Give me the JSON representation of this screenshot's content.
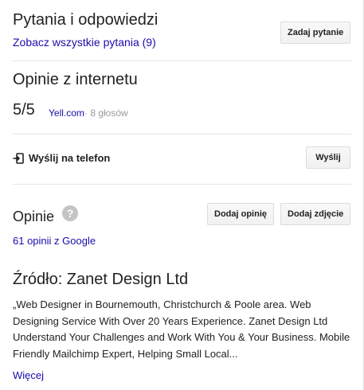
{
  "qa": {
    "title": "Pytania i odpowiedzi",
    "see_all_link": "Zobacz wszystkie pytania (9)",
    "ask_button": "Zadaj pytanie"
  },
  "web_reviews": {
    "title": "Opinie z internetu",
    "score": "5/5",
    "source": "Yell.com",
    "votes": "· 8 głosów"
  },
  "send_to_phone": {
    "label": "Wyślij na telefon",
    "icon": "send-to-phone-icon",
    "button": "Wyślij"
  },
  "reviews": {
    "title": "Opinie",
    "help_icon_glyph": "?",
    "add_review_button": "Dodaj opinię",
    "add_photo_button": "Dodaj zdjęcie",
    "google_reviews_link": "61 opinii z Google"
  },
  "source": {
    "title": "Źródło: Zanet Design Ltd",
    "description": "„Web Designer in Bournemouth, Christchurch & Poole area. Web Designing Service With Over 20 Years Experience. Zanet Design Ltd Understand Your Challenges and Work With You & Your Business. Mobile Friendly Mailchimp Expert, Helping Small Local...",
    "more_link": "Więcej"
  },
  "colors": {
    "link": "#1a0dab",
    "text": "#222222",
    "muted": "#999999",
    "divider": "#e5e5e5"
  }
}
